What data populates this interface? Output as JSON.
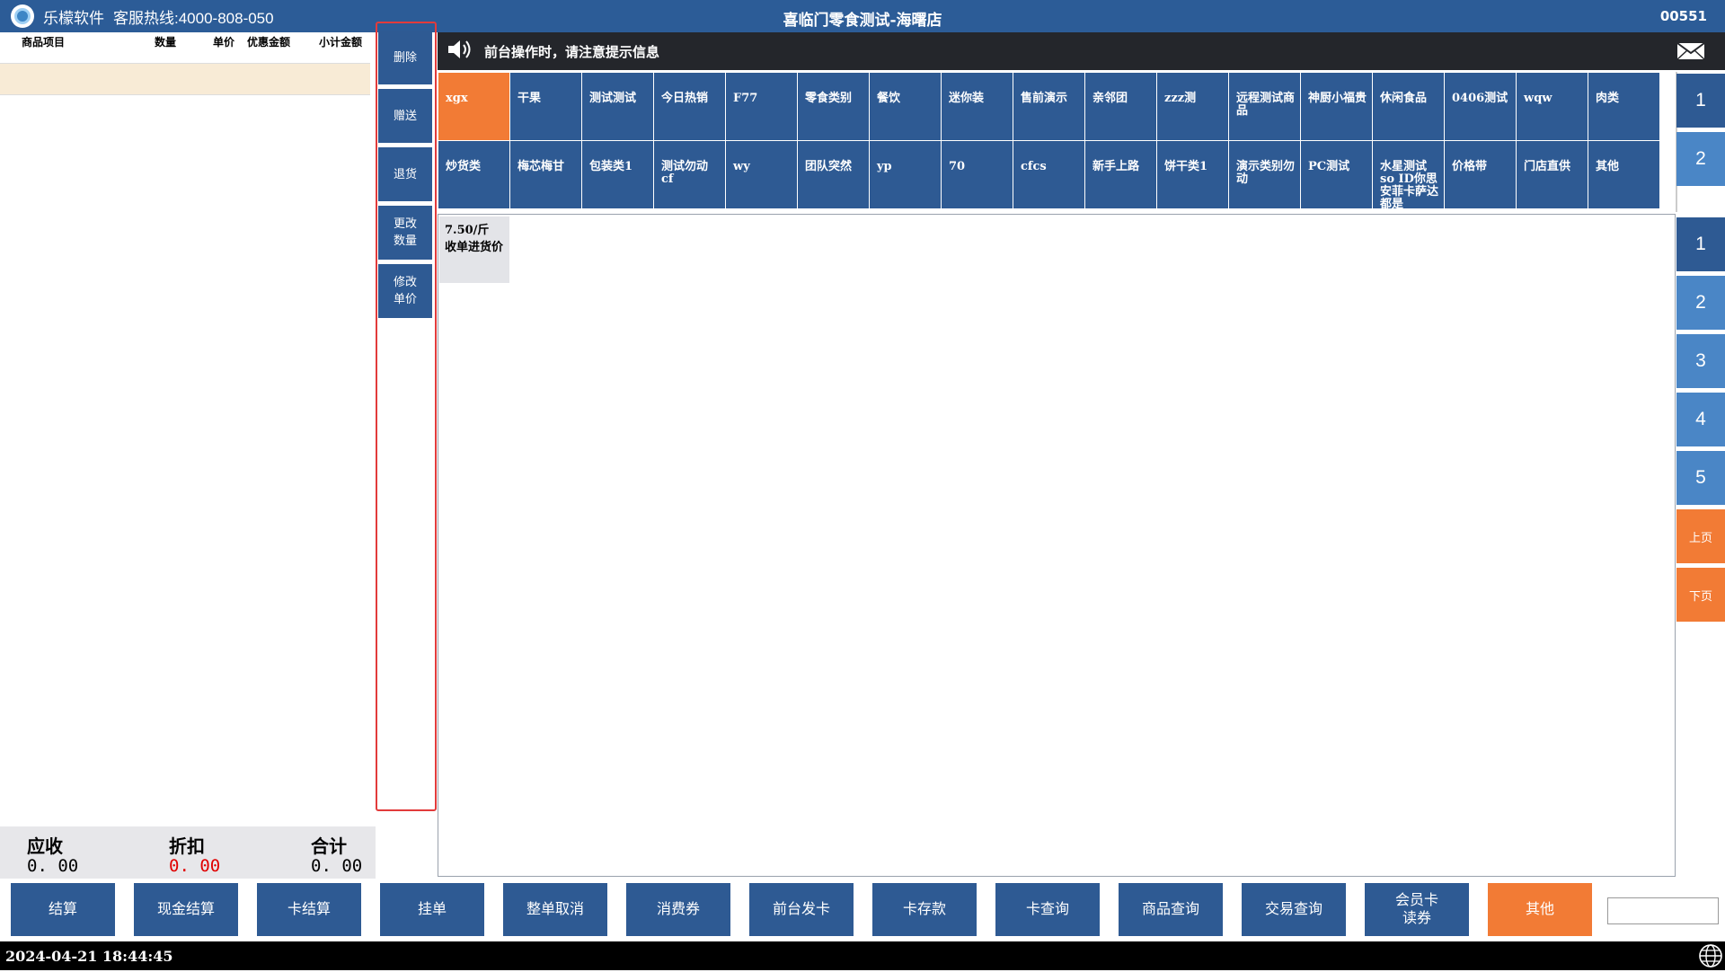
{
  "titlebar": {
    "brand": "乐檬软件",
    "hotline": "客服热线:4000-808-050",
    "store_title": "喜临门零食测试-海曙店",
    "order_no": "00551"
  },
  "order_table": {
    "headers": [
      "商品项目",
      "数量",
      "单价",
      "优惠金额",
      "小计金额"
    ]
  },
  "totals": {
    "receivable_label": "应收",
    "receivable_value": "0. 00",
    "discount_label": "折扣",
    "discount_value": "0. 00",
    "total_label": "合计",
    "total_value": "0. 00",
    "discount_color": "#e00000"
  },
  "actions": [
    "删除",
    "赠送",
    "退货",
    "更改数量",
    "修改单价"
  ],
  "notice": {
    "text": "前台操作时，请注意提示信息",
    "speaker_icon": "speaker-icon",
    "mail_icon": "mail-icon"
  },
  "categories": {
    "row1": [
      "xgx",
      "干果",
      "测试测试",
      "今日热销",
      "F77",
      "零食类别",
      "餐饮",
      "迷你装",
      "售前演示",
      "亲邻团",
      "zzz测",
      "远程测试商品",
      "神厨小福贵",
      "休闲食品",
      "0406测试",
      "wqw",
      "肉类"
    ],
    "row2": [
      "炒货类",
      "梅芯梅甘",
      "包装类1",
      "测试勿动cf",
      "wy",
      "团队突然",
      "yp",
      "70",
      "cfcs",
      "新手上路",
      "饼干类1",
      "演示类别勿动",
      "PC测试",
      "水星测试so ID你思安菲卡萨达都是",
      "价格带",
      "门店直供",
      "其他"
    ],
    "active": "xgx"
  },
  "products": [
    {
      "price": "7.50/斤",
      "name": "收单进货价"
    }
  ],
  "category_pages": [
    "1",
    "2"
  ],
  "product_pages": [
    "1",
    "2",
    "3",
    "4",
    "5"
  ],
  "page_nav": {
    "prev": "上页",
    "next": "下页"
  },
  "functions": [
    "结算",
    "现金结算",
    "卡结算",
    "挂单",
    "整单取消",
    "消费券",
    "前台发卡",
    "卡存款",
    "卡查询",
    "商品查询",
    "交易查询",
    "会员卡读券",
    "其他"
  ],
  "status": {
    "datetime": "2024-04-21 18:44:45"
  },
  "colors": {
    "primary": "#2e5a93",
    "accent": "#f27b35",
    "titlebar": "#2c5c97"
  }
}
